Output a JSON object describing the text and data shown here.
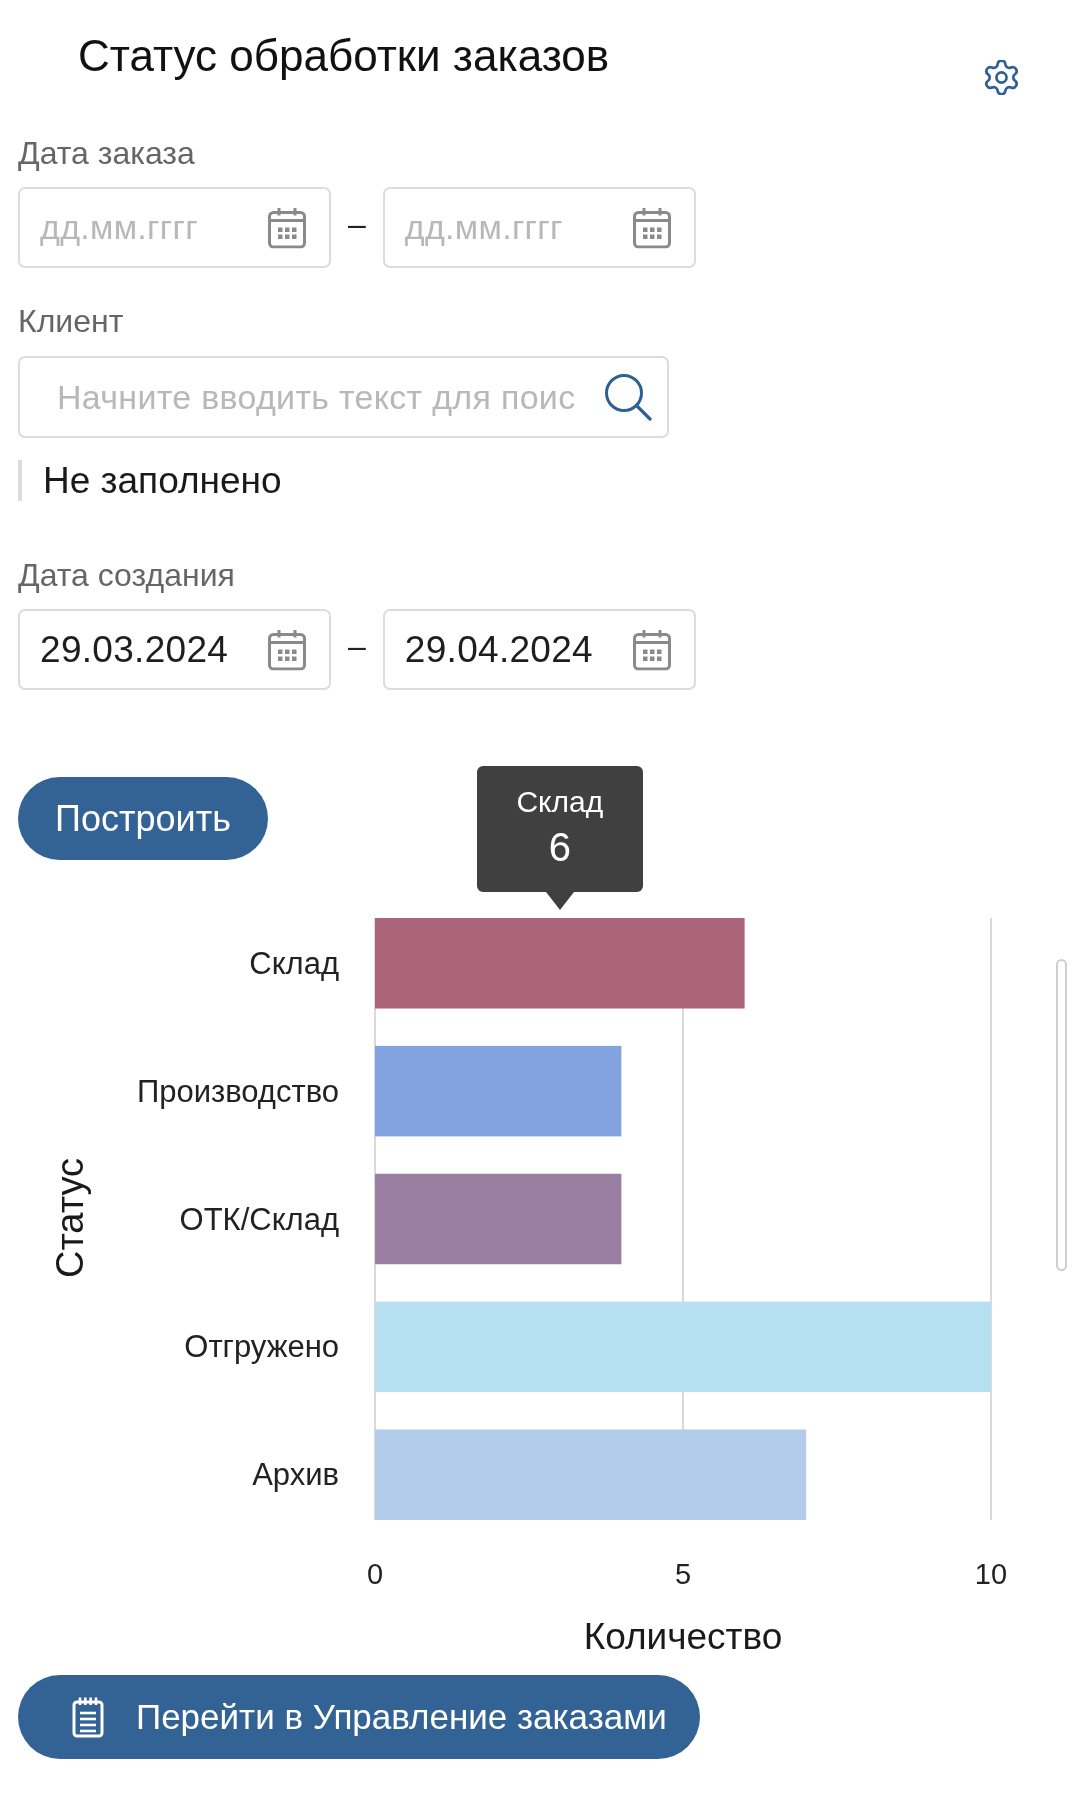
{
  "header": {
    "title": "Статус обработки заказов"
  },
  "filters": {
    "order_date": {
      "label": "Дата заказа",
      "from": {
        "placeholder": "дд.мм.гггг"
      },
      "separator": "–",
      "to": {
        "placeholder": "дд.мм.гггг"
      }
    },
    "client": {
      "label": "Клиент",
      "search": {
        "placeholder": "Начните вводить текст для поис"
      },
      "selection": "Не заполнено"
    },
    "creation_date": {
      "label": "Дата создания",
      "from": {
        "value": "29.03.2024"
      },
      "separator": "–",
      "to": {
        "value": "29.04.2024"
      }
    }
  },
  "build_button": {
    "label": "Построить"
  },
  "chart": {
    "tooltip": {
      "label": "Склад",
      "value": "6"
    },
    "chart_data": {
      "type": "bar",
      "orientation": "horizontal",
      "xlabel": "Количество",
      "ylabel": "Статус",
      "categories": [
        "Склад",
        "Производство",
        "ОТК/Склад",
        "Отгружено",
        "Архив"
      ],
      "series": [
        {
          "values": [
            6,
            4,
            4,
            10,
            7
          ],
          "colors": [
            "#ab6479",
            "#82a3de",
            "#9a7fa3",
            "#b6dff1",
            "#b3cce9"
          ]
        }
      ],
      "xlim": [
        0,
        10
      ],
      "xticks": [
        0,
        5,
        10
      ]
    }
  },
  "footer_button": {
    "label": "Перейти в Управление заказами"
  }
}
